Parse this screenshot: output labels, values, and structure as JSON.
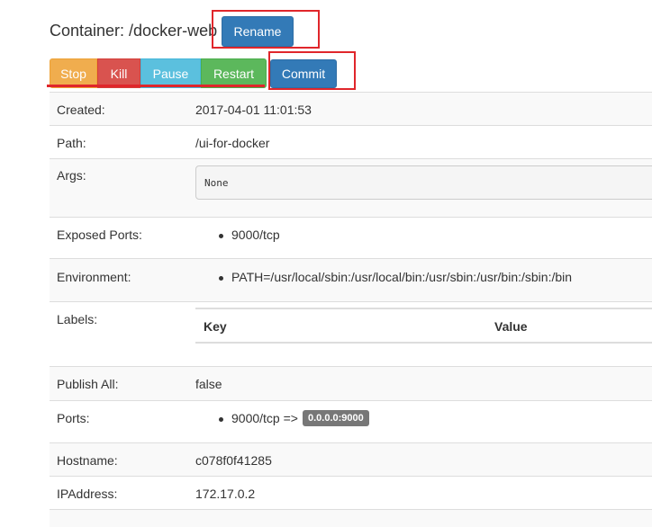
{
  "header": {
    "title": "Container: /docker-web",
    "rename_label": "Rename"
  },
  "actions": {
    "stop": "Stop",
    "kill": "Kill",
    "pause": "Pause",
    "restart": "Restart",
    "commit": "Commit"
  },
  "details": {
    "created": {
      "label": "Created:",
      "value": "2017-04-01 11:01:53"
    },
    "path": {
      "label": "Path:",
      "value": "/ui-for-docker"
    },
    "args": {
      "label": "Args:",
      "value": "None"
    },
    "exposed_ports": {
      "label": "Exposed Ports:",
      "items": [
        "9000/tcp"
      ]
    },
    "environment": {
      "label": "Environment:",
      "items": [
        "PATH=/usr/local/sbin:/usr/local/bin:/usr/sbin:/usr/bin:/sbin:/bin"
      ]
    },
    "labels": {
      "label": "Labels:",
      "key_header": "Key",
      "value_header": "Value"
    },
    "publish_all": {
      "label": "Publish All:",
      "value": "false"
    },
    "ports": {
      "label": "Ports:",
      "mapping": "9000/tcp =>",
      "host_binding": "0.0.0.0:9000"
    },
    "hostname": {
      "label": "Hostname:",
      "value": "c078f0f41285"
    },
    "ip_address": {
      "label": "IPAddress:",
      "value": "172.17.0.2"
    }
  },
  "colors": {
    "primary": "#337ab7",
    "warning": "#f0ad4e",
    "danger": "#d9534f",
    "info": "#5bc0de",
    "success": "#5cb85c",
    "annotation": "#e0262b"
  }
}
